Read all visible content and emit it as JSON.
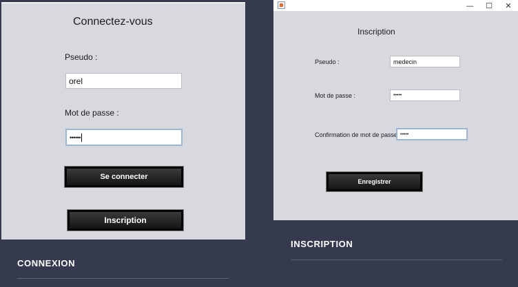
{
  "connexion": {
    "title": "Connectez-vous",
    "pseudo_label": "Pseudo :",
    "pseudo_value": "orel",
    "password_label": "Mot de passe :",
    "password_value": "••••••",
    "login_button": "Se connecter",
    "register_button": "Inscription",
    "caption": "CONNEXION"
  },
  "inscription": {
    "window_controls": {
      "minimize": "—",
      "maximize": "☐",
      "close": "✕"
    },
    "title": "Inscription",
    "pseudo_label": "Pseudo :",
    "pseudo_value": "medecin",
    "password_label": "Mot de passe :",
    "password_value": "•••••",
    "confirm_label": "Confirmation de mot de passe :",
    "confirm_value": "•••••",
    "register_button": "Enregistrer",
    "caption": "INSCRIPTION"
  },
  "icons": {
    "app": "java-app-icon",
    "minimize": "minimize-icon",
    "maximize": "maximize-icon",
    "close": "close-icon"
  }
}
